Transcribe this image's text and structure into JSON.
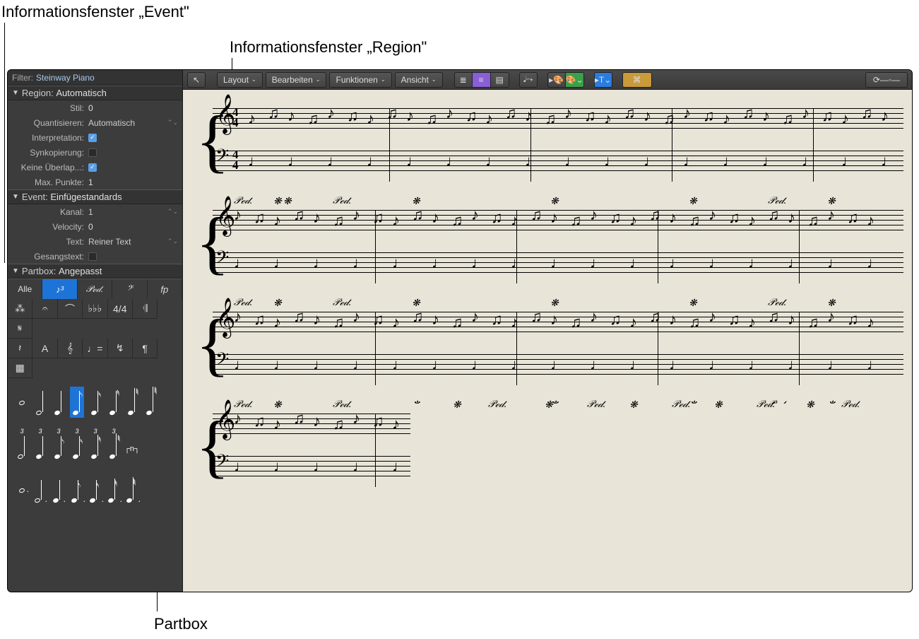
{
  "callouts": {
    "event_inspector": "Informationsfenster „Event\"",
    "region_inspector": "Informationsfenster „Region\"",
    "partbox": "Partbox"
  },
  "filter": {
    "label": "Filter:",
    "value": "Steinway Piano"
  },
  "region": {
    "title": "Region:",
    "value": "Automatisch",
    "style_label": "Stil:",
    "style_value": "0",
    "quantize_label": "Quantisieren:",
    "quantize_value": "Automatisch",
    "interpretation_label": "Interpretation:",
    "interpretation_checked": true,
    "syncopation_label": "Synkopierung:",
    "syncopation_checked": false,
    "nooverlap_label": "Keine Überlap...:",
    "nooverlap_checked": true,
    "maxdots_label": "Max. Punkte:",
    "maxdots_value": "1"
  },
  "event": {
    "title": "Event:",
    "value": "Einfügestandards",
    "channel_label": "Kanal:",
    "channel_value": "1",
    "velocity_label": "Velocity:",
    "velocity_value": "0",
    "text_label": "Text:",
    "text_value": "Reiner Text",
    "lyrics_label": "Gesangstext:",
    "lyrics_checked": false
  },
  "partbox": {
    "title": "Partbox:",
    "value": "Angepasst",
    "tabs": [
      "Alle",
      "♪³",
      "𝒫ℯ𝒹.",
      "𝄢",
      "fp"
    ],
    "grid_row1": [
      "⁂",
      "𝄐",
      "⌒",
      "♭♭♭",
      "4/4",
      "𝄇",
      "𝄋"
    ],
    "grid_row2": [
      "𝄽",
      "A",
      "𝄞",
      "♩=",
      "↯",
      "¶",
      "▦"
    ]
  },
  "toolbar": {
    "back": "↖",
    "layout": "Layout",
    "edit": "Bearbeiten",
    "functions": "Funktionen",
    "view": "Ansicht"
  },
  "score": {
    "time_top": "4",
    "time_bot": "4",
    "ped": "𝒫ℯ𝒹.",
    "star": "❋"
  }
}
